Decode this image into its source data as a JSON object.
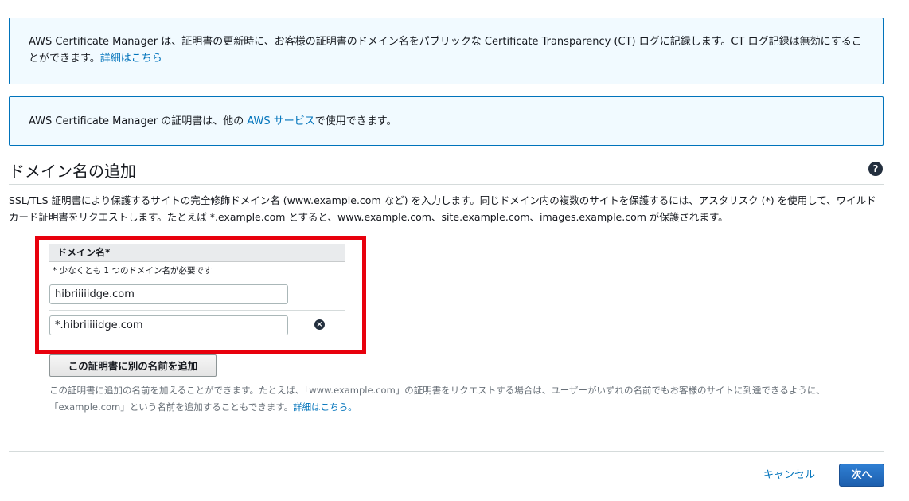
{
  "info_ct": {
    "text": "AWS Certificate Manager は、証明書の更新時に、お客様の証明書のドメイン名をパブリックな Certificate Transparency (CT) ログに記録します。CT ログ記録は無効にすることができます。",
    "link": "詳細はこちら"
  },
  "info_services": {
    "prefix": "AWS Certificate Manager の証明書は、他の ",
    "link": "AWS サービス",
    "suffix": "で使用できます。"
  },
  "section": {
    "title": "ドメイン名の追加",
    "help_icon": "question-circle-icon",
    "description": "SSL/TLS 証明書により保護するサイトの完全修飾ドメイン名 (www.example.com など) を入力します。同じドメイン内の複数のサイトを保護するには、アスタリスク (*) を使用して、ワイルドカード証明書をリクエストします。たとえば *.example.com とすると、www.example.com、site.example.com、images.example.com が保護されます。"
  },
  "domain_table": {
    "header": "ドメイン名*",
    "required_note": "* 少なくとも 1 つのドメイン名が必要です",
    "rows": [
      {
        "value": "hibriiiiidge.com"
      },
      {
        "value": "*.hibriiiiidge.com",
        "remove_icon": "remove-circle-icon"
      }
    ]
  },
  "add_name_button": "この証明書に別の名前を追加",
  "hint": {
    "text": "この証明書に追加の名前を加えることができます。たとえば、「www.example.com」の証明書をリクエストする場合は、ユーザーがいずれの名前でもお客様のサイトに到達できるように、「example.com」という名前を追加することもできます。",
    "link": "詳細はこちら。"
  },
  "footer": {
    "cancel": "キャンセル",
    "next": "次へ"
  },
  "colors": {
    "info_border": "#0073bb",
    "info_bg": "#f1faff",
    "highlight": "#e8000d",
    "primary_button": "#1d5fae",
    "link": "#0073bb"
  }
}
